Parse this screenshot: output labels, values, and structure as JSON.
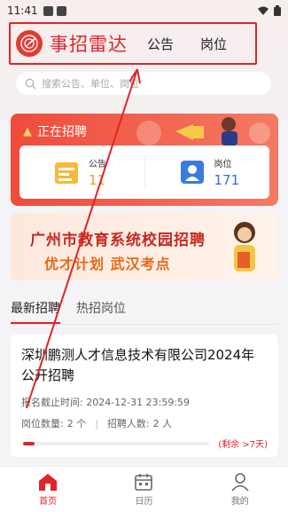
{
  "status_bar": {
    "time": "11:41"
  },
  "header": {
    "brand": "事招雷达",
    "nav_tabs": [
      {
        "label": "公告"
      },
      {
        "label": "岗位"
      }
    ]
  },
  "search": {
    "placeholder": "搜索公告、单位、岗位"
  },
  "hiring": {
    "title": "正在招聘",
    "stats": [
      {
        "label": "公告",
        "value": "11"
      },
      {
        "label": "岗位",
        "value": "171"
      }
    ]
  },
  "banner": {
    "line1": "广州市教育系统校园招聘",
    "line2": "优才计划  武汉考点"
  },
  "tabs": [
    {
      "label": "最新招聘"
    },
    {
      "label": "热招岗位"
    }
  ],
  "job_card": {
    "title": "深圳鹏测人才信息技术有限公司2024年公开招聘",
    "deadline_label": "报名截止时间:",
    "deadline": "2024-12-31 23:59:59",
    "positions_label": "岗位数量:",
    "positions": "2 个",
    "hires_label": "招聘人数:",
    "hires": "2 人",
    "progress_fraction": 0.06,
    "remaining": "(剩余 >7天)"
  },
  "bottom_nav": [
    {
      "label": "首页",
      "icon": "home-icon",
      "active": true
    },
    {
      "label": "日历",
      "icon": "calendar-icon",
      "active": false
    },
    {
      "label": "我的",
      "icon": "profile-icon",
      "active": false
    }
  ],
  "colors": {
    "accent": "#e0242a",
    "stat_gold": "#f0a020",
    "stat_blue": "#2a6fd8"
  }
}
